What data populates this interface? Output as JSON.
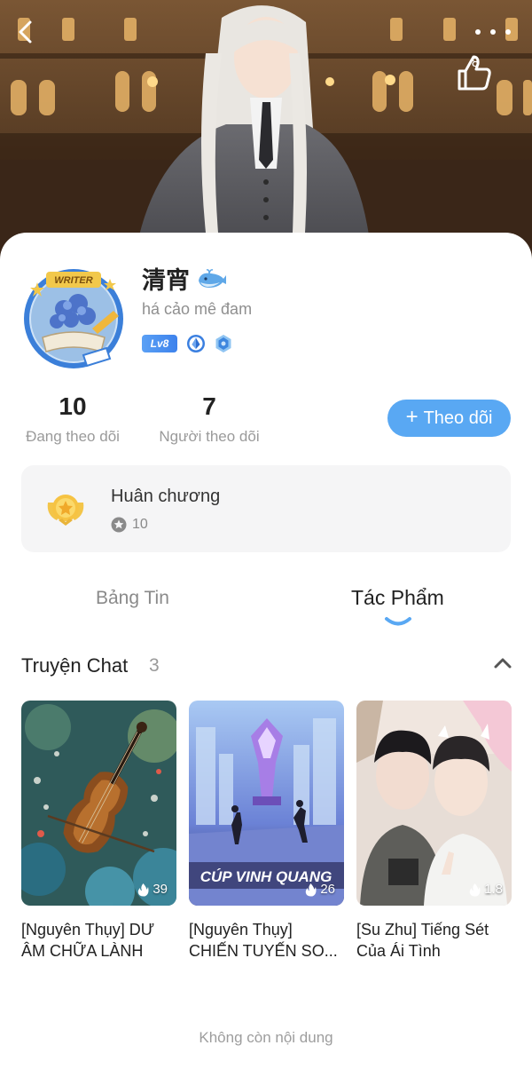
{
  "header": {
    "back_icon": "chevron-left-icon",
    "more_icon": "more-dots-icon",
    "like_icon": "thumbs-up-icon",
    "like_count": "8"
  },
  "profile": {
    "name": "清宵",
    "name_icon": "whale-icon",
    "bio": "há cảo mê đam",
    "avatar_badge": "WRITER",
    "level": "Lv8",
    "badge_icons": [
      "droplet-gem-icon",
      "hexagon-gem-icon"
    ]
  },
  "stats": {
    "following_count": "10",
    "following_label": "Đang theo dõi",
    "followers_count": "7",
    "followers_label": "Người theo dõi"
  },
  "follow_button": {
    "plus": "+",
    "label": "Theo dõi",
    "color": "#59a8f3"
  },
  "medals": {
    "title": "Huân chương",
    "count": "10",
    "icon": "medal-icon"
  },
  "tabs": [
    {
      "label": "Bảng Tin",
      "active": false
    },
    {
      "label": "Tác Phẩm",
      "active": true
    }
  ],
  "section": {
    "title": "Truyện Chat",
    "count": "3",
    "collapse_icon": "chevron-up-icon"
  },
  "stories": [
    {
      "title": "[Nguyên Thụy] DƯ ÂM CHỮA LÀNH",
      "heat": "39",
      "cover": "violin-painting"
    },
    {
      "title": "[Nguyên Thụy] CHIẾN TUYẾN SO...",
      "heat": "26",
      "cover_text": "CÚP VINH QUANG",
      "cover": "esports-trophy"
    },
    {
      "title": "[Su Zhu] Tiếng Sét Của Ái Tình",
      "heat": "1.8",
      "cover": "two-boys-photo"
    }
  ],
  "footer": {
    "end_text": "Không còn nội dung"
  },
  "colors": {
    "accent": "#59a8f3",
    "card_bg": "#f5f5f6",
    "muted": "#9a9a9a"
  }
}
